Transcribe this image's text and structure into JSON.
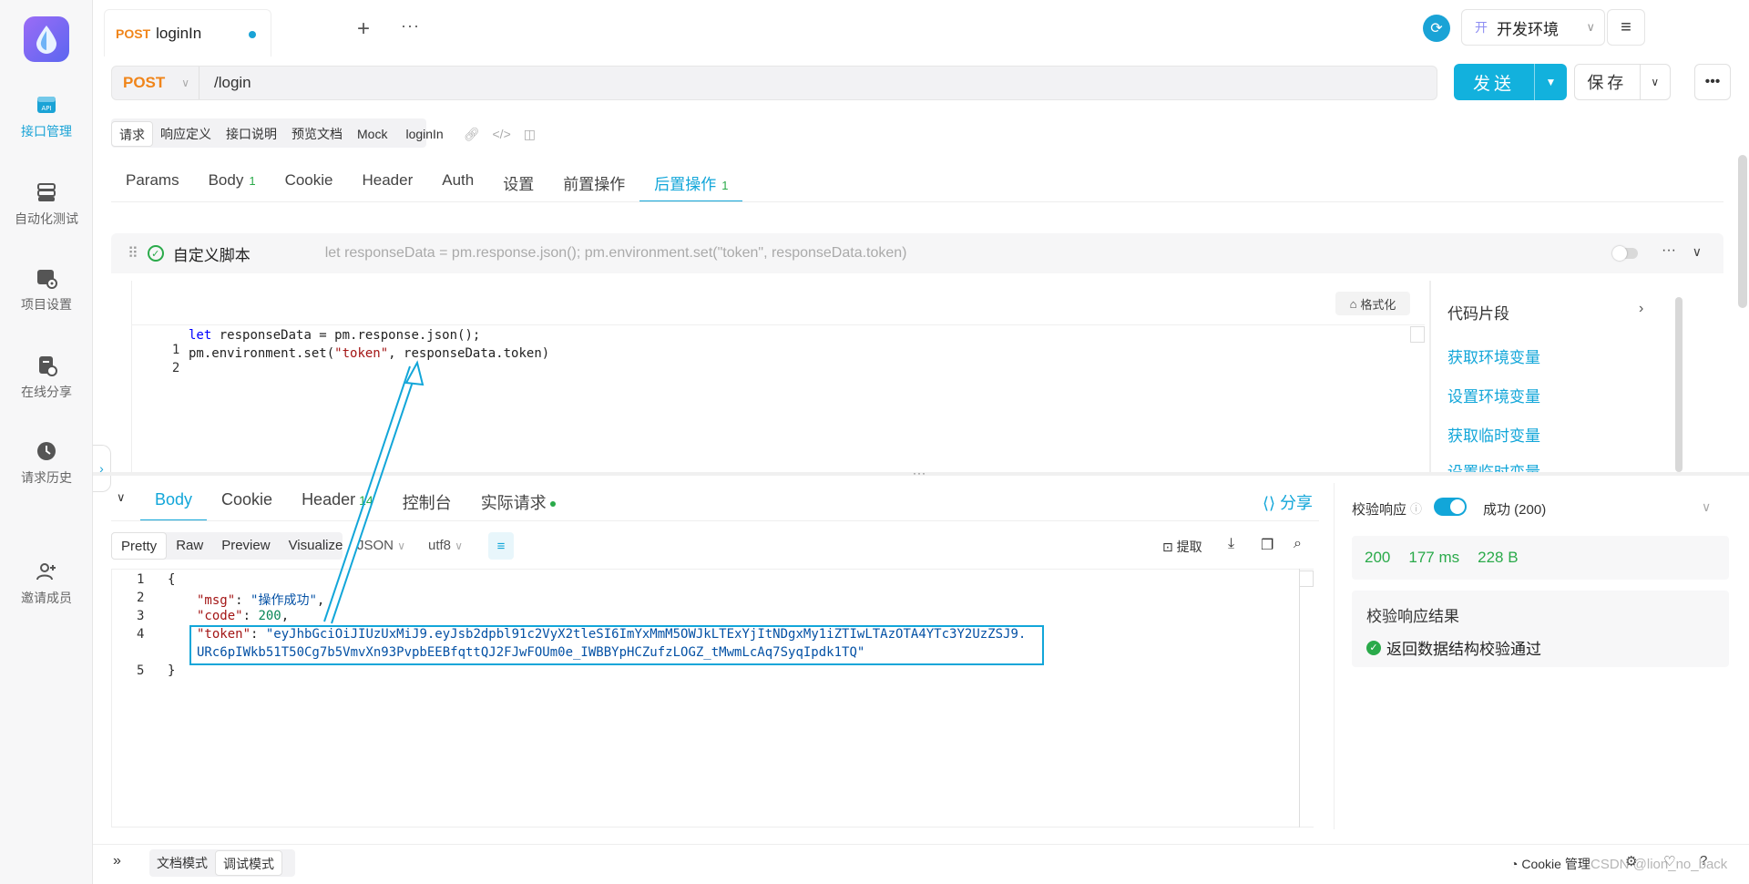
{
  "sidebar": {
    "items": [
      {
        "label": "接口管理",
        "icon": "api-icon"
      },
      {
        "label": "自动化测试",
        "icon": "database-icon"
      },
      {
        "label": "项目设置",
        "icon": "project-settings-icon"
      },
      {
        "label": "在线分享",
        "icon": "share-doc-icon"
      },
      {
        "label": "请求历史",
        "icon": "history-icon"
      },
      {
        "label": "邀请成员",
        "icon": "add-user-icon"
      }
    ]
  },
  "tabbar": {
    "method": "POST",
    "title": "loginIn",
    "add": "+",
    "more": "···",
    "env_badge": "开",
    "env_name": "开发环境"
  },
  "request": {
    "method": "POST",
    "url": "/login",
    "send_label": "发送",
    "save_label": "保存"
  },
  "doc_tabs": [
    "请求",
    "响应定义",
    "接口说明",
    "预览文档",
    "Mock",
    "loginIn"
  ],
  "req_tabs": [
    {
      "label": "Params",
      "count": ""
    },
    {
      "label": "Body",
      "count": "1"
    },
    {
      "label": "Cookie",
      "count": ""
    },
    {
      "label": "Header",
      "count": ""
    },
    {
      "label": "Auth",
      "count": ""
    },
    {
      "label": "设置",
      "count": ""
    },
    {
      "label": "前置操作",
      "count": ""
    },
    {
      "label": "后置操作",
      "count": "1"
    }
  ],
  "script": {
    "title": "自定义脚本",
    "preview": "let responseData = pm.response.json(); pm.environment.set(\"token\", responseData.token)",
    "format_label": "格式化",
    "lines": [
      {
        "n": "1",
        "kw": "let",
        "rest": " responseData = pm.response.json();"
      },
      {
        "n": "2",
        "pre": "pm.environment.set(",
        "str": "\"token\"",
        "post": ", responseData.token)"
      }
    ]
  },
  "snippets": {
    "title": "代码片段",
    "items": [
      "获取环境变量",
      "设置环境变量",
      "获取临时变量",
      "设置临时变量"
    ]
  },
  "response": {
    "tabs": [
      {
        "label": "Body",
        "count": ""
      },
      {
        "label": "Cookie",
        "count": ""
      },
      {
        "label": "Header",
        "count": "14"
      },
      {
        "label": "控制台",
        "count": ""
      },
      {
        "label": "实际请求",
        "count": ""
      }
    ],
    "share_label": "分享",
    "view_tabs": [
      "Pretty",
      "Raw",
      "Preview",
      "Visualize"
    ],
    "format": "JSON",
    "charset": "utf8",
    "extract_label": "提取",
    "json": {
      "open": "{",
      "msg_key": "\"msg\"",
      "msg_val": "\"操作成功\"",
      "code_key": "\"code\"",
      "code_val": "200",
      "token_key": "\"token\"",
      "token_val_1": "\"eyJhbGciOiJIUzUxMiJ9.eyJsb2dpbl91c2VyX2tleSI6ImYxMmM5OWJkLTExYjItNDgxMy1iZTIwLTAzOTA4YTc3Y2UzZSJ9.",
      "token_val_2": "URc6pIWkb51T50Cg7b5VmvXn93PvpbEEBfqttQJ2FJwFOUm0e_IWBBYpHCZufzLOGZ_tMwmLcAq7SyqIpdk1TQ\"",
      "close": "}",
      "line_numbers": [
        "1",
        "2",
        "3",
        "4",
        "5"
      ]
    }
  },
  "validation": {
    "label": "校验响应",
    "status": "成功 (200)",
    "status_code": "200",
    "time": "177 ms",
    "size": "228 B",
    "result_title": "校验响应结果",
    "result_item": "返回数据结构校验通过"
  },
  "bottom": {
    "modes": [
      "文档模式",
      "调试模式"
    ],
    "cookie_label": "Cookie 管理",
    "watermark": "CSDN @lion_no_back"
  },
  "colors": {
    "accent": "#12a6d9",
    "post": "#f0851a",
    "success": "#2aaa4a"
  }
}
